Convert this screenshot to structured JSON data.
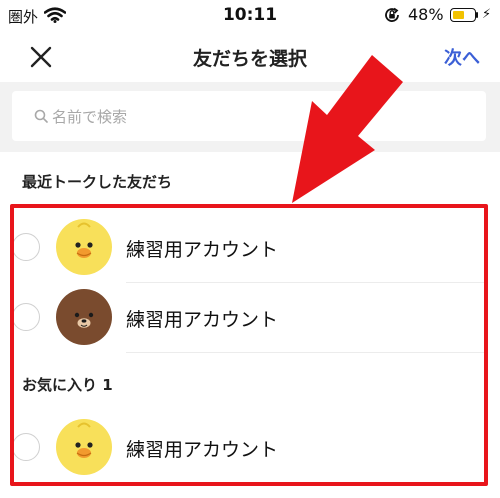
{
  "status_bar": {
    "carrier": "圏外",
    "time": "10:11",
    "battery_percent": "48%",
    "battery_level": 0.45,
    "battery_color": "#f2c200"
  },
  "nav": {
    "title": "友だちを選択",
    "next_label": "次へ",
    "close_icon": "close-icon",
    "accent": "#3b5fd6"
  },
  "search": {
    "placeholder": "名前で検索",
    "value": ""
  },
  "sections": {
    "recent": "最近トークした友だち",
    "favorites": "お気に入り 1"
  },
  "friends": [
    {
      "name": "練習用アカウント",
      "avatar": "yellow-chick-avatar",
      "selected": false
    },
    {
      "name": "練習用アカウント",
      "avatar": "brown-bear-avatar",
      "selected": false
    },
    {
      "name": "練習用アカウント",
      "avatar": "yellow-chick-avatar",
      "selected": false
    }
  ],
  "annotation": {
    "color": "#e8151b"
  }
}
